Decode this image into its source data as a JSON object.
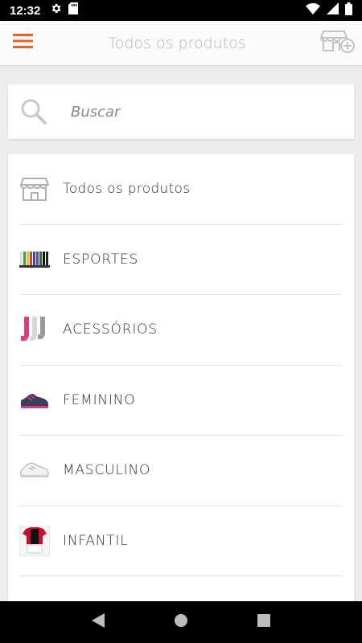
{
  "status_bar": {
    "time": "12:32"
  },
  "app_bar": {
    "title": "Todos os produtos"
  },
  "search": {
    "placeholder": "Buscar"
  },
  "categories": [
    {
      "label": "Todos os produtos",
      "icon": "store-icon"
    },
    {
      "label": "ESPORTES",
      "icon": "colored-socks-thumb"
    },
    {
      "label": "ACESSÓRIOS",
      "icon": "socks-thumb"
    },
    {
      "label": "FEMININO",
      "icon": "sneaker-thumb"
    },
    {
      "label": "MASCULINO",
      "icon": "white-sneaker-thumb"
    },
    {
      "label": "INFANTIL",
      "icon": "kids-uniform-thumb"
    }
  ],
  "colors": {
    "accent": "#e8622c",
    "title": "#b9b9b9"
  }
}
